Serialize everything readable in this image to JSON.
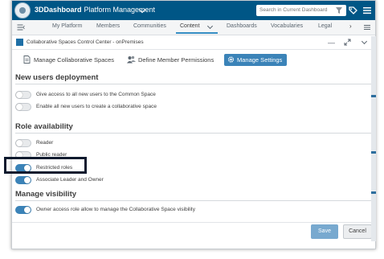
{
  "topbar": {
    "app_name": "3DDashboard",
    "dashboard_name": "Platform Management",
    "search_placeholder": "Search in Current Dashboard"
  },
  "tabs": [
    {
      "label": "My Platform"
    },
    {
      "label": "Members"
    },
    {
      "label": "Communities"
    },
    {
      "label": "Content",
      "active": true
    },
    {
      "label": "Dashboards"
    },
    {
      "label": "Vocabularies"
    },
    {
      "label": "Legal"
    }
  ],
  "widget": {
    "title": "Collaborative Spaces Control Center - onPremises"
  },
  "subtabs": [
    {
      "label": "Manage Collaborative Spaces",
      "icon": "document-icon"
    },
    {
      "label": "Define Member Permissions",
      "icon": "users-icon"
    },
    {
      "label": "Manage Settings",
      "icon": "gear-icon",
      "active": true
    }
  ],
  "sections": {
    "new_users": {
      "title": "New users deployment",
      "options": [
        {
          "label": "Give access to all new users to the Common Space",
          "enabled": false
        },
        {
          "label": "Enable all new users to create a collaborative space",
          "enabled": false
        }
      ]
    },
    "role_availability": {
      "title": "Role availability",
      "options": [
        {
          "label": "Reader",
          "enabled": false
        },
        {
          "label": "Public reader",
          "enabled": false
        },
        {
          "label": "Restricted roles",
          "enabled": true
        },
        {
          "label": "Associate Leader and Owner",
          "enabled": true
        }
      ]
    },
    "visibility": {
      "title": "Manage visibility",
      "options": [
        {
          "label": "Owner access role allow to manage the Collaborative Space visibility",
          "enabled": true
        }
      ]
    }
  },
  "footer": {
    "save_label": "Save",
    "cancel_label": "Cancel"
  },
  "colors": {
    "topbar": "#005686",
    "accent": "#3b83b8",
    "highlight_border": "#0e1a2e"
  }
}
